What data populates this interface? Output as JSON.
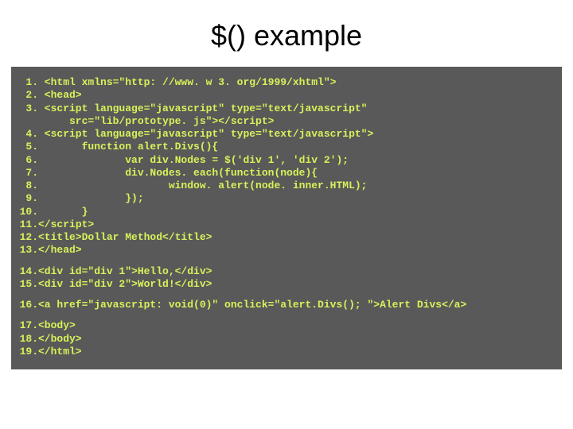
{
  "title": "$() example",
  "code": {
    "l1": {
      "n": "1.",
      "t": " <html xmlns=\"http: //www. w 3. org/1999/xhtml\">"
    },
    "l2": {
      "n": "2.",
      "t": " <head>"
    },
    "l3a": {
      "n": "3.",
      "t": " <script language=\"javascript\" type=\"text/javascript\""
    },
    "l3b": {
      "n": "",
      "t": "     src=\"lib/prototype. js\"></scr"
    },
    "l3b2": "ipt>",
    "l4": {
      "n": "4.",
      "t": " <script language=\"javascript\" type=\"text/javascript\">"
    },
    "l5": {
      "n": "5.",
      "t": "       function alert.Divs(){"
    },
    "l6": {
      "n": "6.",
      "t": "              var div.Nodes = $('div 1', 'div 2');"
    },
    "l7": {
      "n": "7.",
      "t": "              div.Nodes. each(function(node){"
    },
    "l8": {
      "n": "8.",
      "t": "                     window. alert(node. inner.HTML);"
    },
    "l9": {
      "n": "9.",
      "t": "              });"
    },
    "l10": {
      "n": "10.",
      "t": "       }"
    },
    "l11": {
      "n": "11.",
      "t": "</scr"
    },
    "l11b": "ipt>",
    "l12": {
      "n": "12.",
      "t": "<title>Dollar Method</title>"
    },
    "l13": {
      "n": "13.",
      "t": "</head>"
    },
    "l14": {
      "n": "14.",
      "t": "<div id=\"div 1\">Hello,</div>"
    },
    "l15": {
      "n": "15.",
      "t": "<div id=\"div 2\">World!</div>"
    },
    "l16": {
      "n": "16.",
      "t": "<a href=\"javascript: void(0)\" onclick=\"alert.Divs(); \">Alert Divs</a>"
    },
    "l17": {
      "n": "17.",
      "t": "<body>"
    },
    "l18": {
      "n": "18.",
      "t": "</body>"
    },
    "l19": {
      "n": "19.",
      "t": "</html>"
    }
  }
}
